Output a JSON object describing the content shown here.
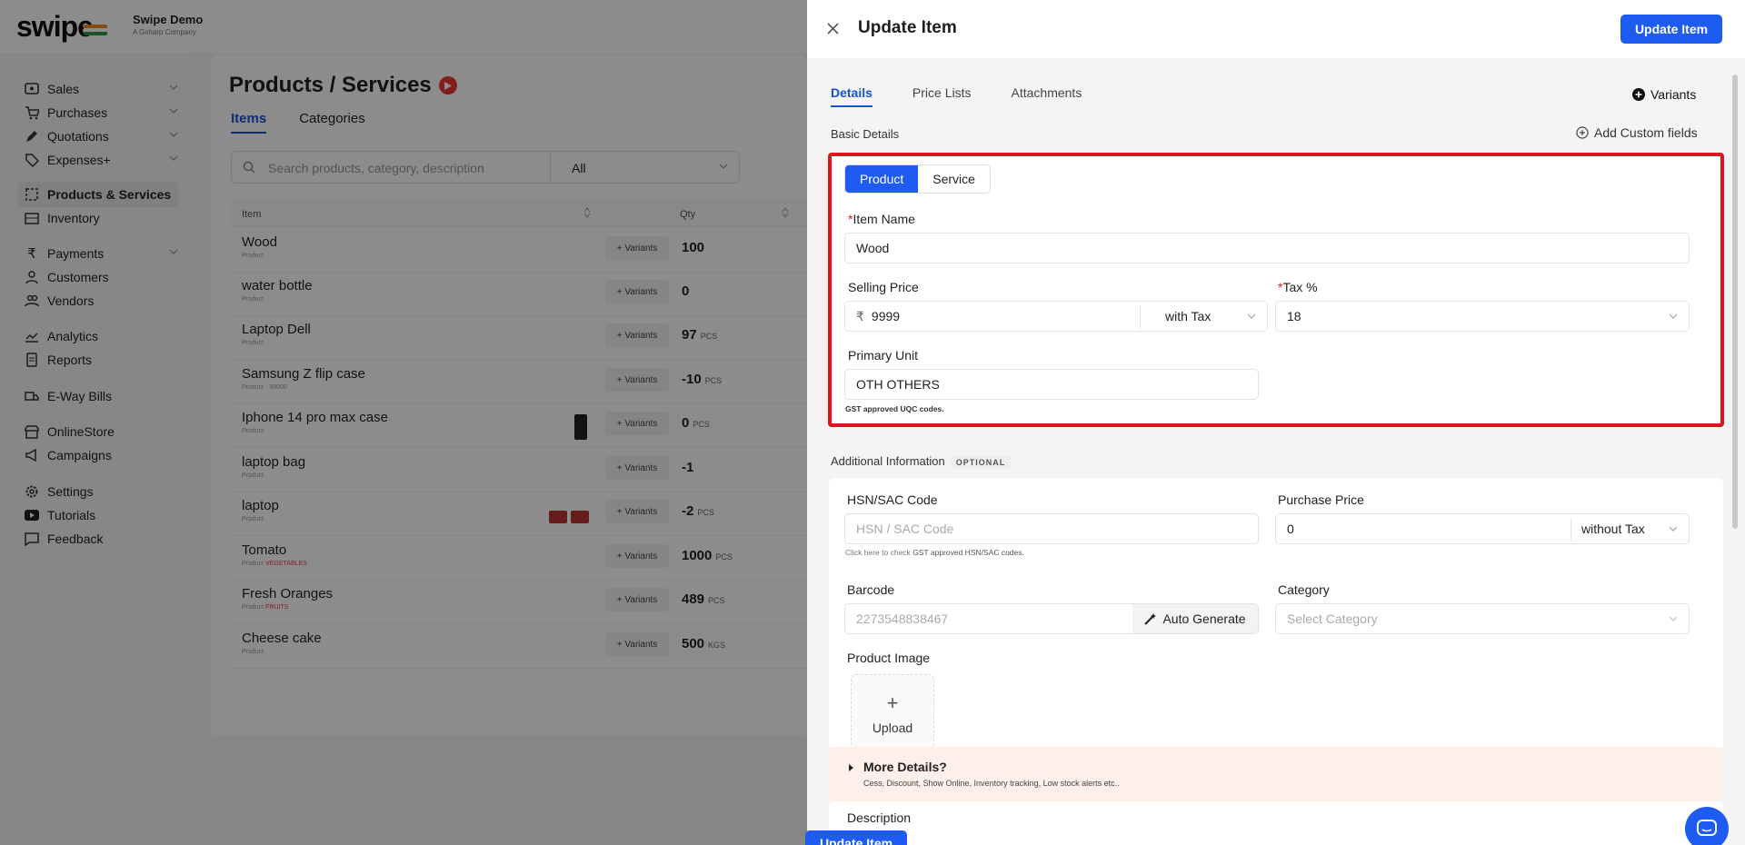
{
  "brand": {
    "logo": "swipe",
    "company": "Swipe Demo",
    "company_sub": "A Gsharp Company"
  },
  "sidebar": {
    "items": [
      {
        "label": "Sales",
        "icon": "sales-icon"
      },
      {
        "label": "Purchases",
        "icon": "cart-icon"
      },
      {
        "label": "Quotations",
        "icon": "pen-icon"
      },
      {
        "label": "Expenses+",
        "icon": "tag-icon"
      },
      {
        "label": "Products & Services",
        "icon": "box-icon"
      },
      {
        "label": "Inventory",
        "icon": "inventory-icon"
      },
      {
        "label": "Payments",
        "icon": "rupee-icon"
      },
      {
        "label": "Customers",
        "icon": "user-icon"
      },
      {
        "label": "Vendors",
        "icon": "users-icon"
      },
      {
        "label": "Analytics",
        "icon": "chart-icon"
      },
      {
        "label": "Reports",
        "icon": "report-icon"
      },
      {
        "label": "E-Way Bills",
        "icon": "truck-icon"
      },
      {
        "label": "OnlineStore",
        "icon": "store-icon"
      },
      {
        "label": "Campaigns",
        "icon": "megaphone-icon"
      },
      {
        "label": "Settings",
        "icon": "gear-icon"
      },
      {
        "label": "Tutorials",
        "icon": "youtube-icon"
      },
      {
        "label": "Feedback",
        "icon": "message-icon"
      }
    ]
  },
  "products": {
    "title": "Products / Services",
    "tabs": [
      "Items",
      "Categories"
    ],
    "search_placeholder": "Search products, category, description",
    "filter": "All",
    "columns": [
      "Item",
      "Qty"
    ],
    "variant_label": "+ Variants",
    "rows": [
      {
        "name": "Wood",
        "sub": "Product",
        "tag": "",
        "qty": "100",
        "unit": ""
      },
      {
        "name": "water bottle",
        "sub": "Product",
        "tag": "",
        "qty": "0",
        "unit": ""
      },
      {
        "name": "Laptop Dell",
        "sub": "Product",
        "tag": "",
        "qty": "97",
        "unit": "PCS"
      },
      {
        "name": "Samsung Z flip case",
        "sub": "Product · 98000",
        "tag": "",
        "qty": "-10",
        "unit": "PCS"
      },
      {
        "name": "Iphone 14 pro max case",
        "sub": "Product",
        "tag": "",
        "qty": "0",
        "unit": "PCS"
      },
      {
        "name": "laptop bag",
        "sub": "Product",
        "tag": "",
        "qty": "-1",
        "unit": ""
      },
      {
        "name": "laptop",
        "sub": "Product",
        "tag": "",
        "qty": "-2",
        "unit": "PCS"
      },
      {
        "name": "Tomato",
        "sub": "Product",
        "tag": "VEGETABLES",
        "qty": "1000",
        "unit": "PCS"
      },
      {
        "name": "Fresh Oranges",
        "sub": "Product",
        "tag": "FRUITS",
        "qty": "489",
        "unit": "PCS"
      },
      {
        "name": "Cheese cake",
        "sub": "Product",
        "tag": "",
        "qty": "500",
        "unit": "KGS"
      }
    ]
  },
  "drawer": {
    "title": "Update Item",
    "update_label": "Update Item",
    "tabs": [
      "Details",
      "Price Lists",
      "Attachments"
    ],
    "variants_label": "Variants",
    "basic_details": "Basic Details",
    "add_custom_fields": "Add Custom fields",
    "type_options": [
      "Product",
      "Service"
    ],
    "item_name_label": "Item Name",
    "item_name_value": "Wood",
    "selling_price_label": "Selling Price",
    "currency_symbol": "₹",
    "selling_price_value": "9999",
    "tax_mode": "with Tax",
    "tax_label": "Tax %",
    "tax_value": "18",
    "primary_unit_label": "Primary Unit",
    "primary_unit_value": "OTH OTHERS",
    "uqc_note": "GST approved UQC codes.",
    "additional_info": "Additional Information",
    "optional_badge": "OPTIONAL",
    "hsn_label": "HSN/SAC Code",
    "hsn_placeholder": "HSN / SAC Code",
    "hsn_note_prefix": "Click here to check",
    "hsn_note_link": "GST approved HSN/SAC codes.",
    "purchase_price_label": "Purchase Price",
    "purchase_price_value": "0",
    "purchase_tax_mode": "without Tax",
    "barcode_label": "Barcode",
    "barcode_placeholder": "2273548838467",
    "auto_generate": "Auto Generate",
    "category_label": "Category",
    "category_placeholder": "Select Category",
    "product_image_label": "Product Image",
    "upload_label": "Upload",
    "more_details_title": "More Details?",
    "more_details_sub": "Cess, Discount, Show Online, Inventory tracking, Low stock alerts etc..",
    "description_label": "Description"
  },
  "colors": {
    "primary": "#1e5bf0",
    "highlight": "#e0141e",
    "more_bg": "#fdf0e8"
  }
}
